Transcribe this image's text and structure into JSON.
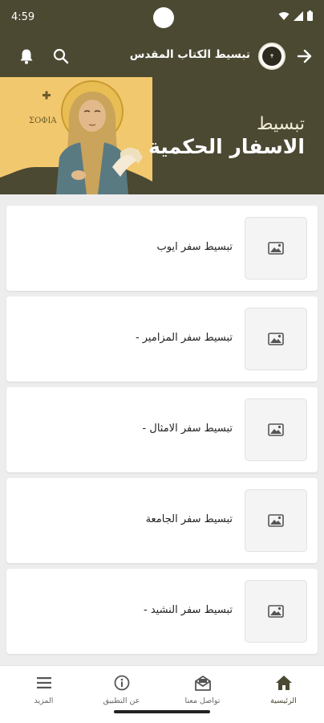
{
  "status": {
    "time": "4:59"
  },
  "header": {
    "title": "تبسيط الكتاب المقدس",
    "logo_text": "HOLY BIBLE"
  },
  "banner": {
    "subtitle": "تبسيط",
    "title": "الاسفار الحكمية",
    "icon_caption": "ΣΟΦΙΑ"
  },
  "items": [
    {
      "label": "تبسيط سفر ايوب"
    },
    {
      "label": "تبسيط سفر المزامير -"
    },
    {
      "label": "تبسيط سفر الامثال -"
    },
    {
      "label": "تبسيط سفر الجامعة"
    },
    {
      "label": "تبسيط سفر النشيد -"
    }
  ],
  "nav": {
    "home": "الرئيسية",
    "contact": "تواصل معنا",
    "about": "عن التطبيق",
    "more": "المزيد"
  },
  "colors": {
    "brand": "#4b4932",
    "background": "#ededed"
  }
}
